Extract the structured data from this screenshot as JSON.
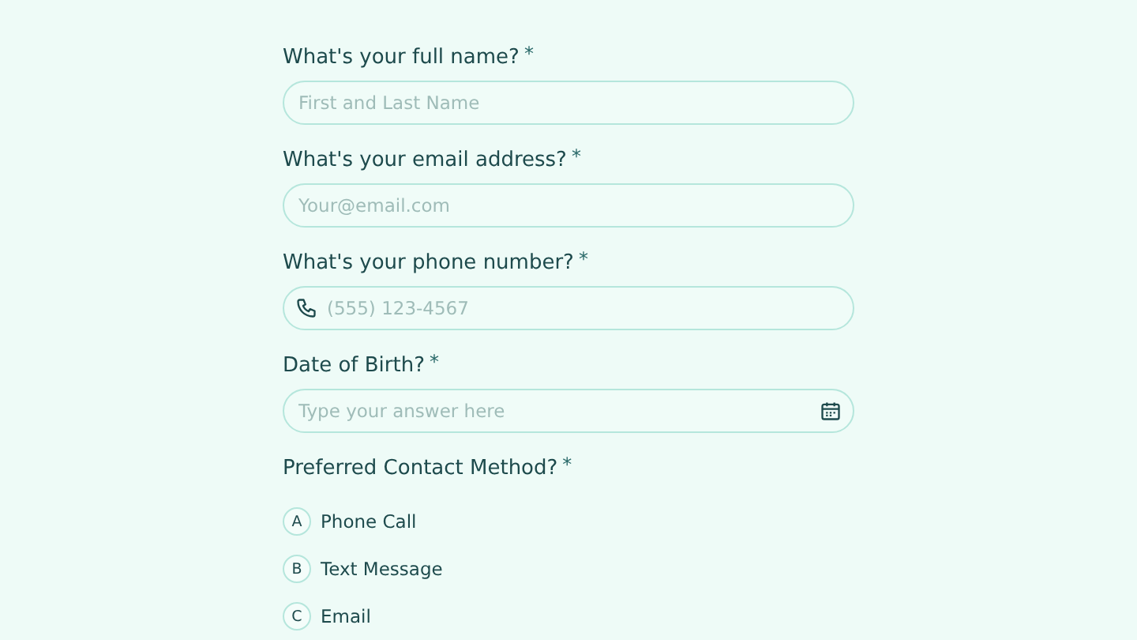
{
  "fields": [
    {
      "kind": "text",
      "label": "What's your full name?",
      "required_mark": "*",
      "placeholder": "First and Last Name"
    },
    {
      "kind": "text",
      "label": "What's your email address?",
      "required_mark": "*",
      "placeholder": "Your@email.com"
    },
    {
      "kind": "phone",
      "label": "What's your phone number?",
      "required_mark": "*",
      "placeholder": "(555) 123-4567"
    },
    {
      "kind": "date",
      "label": "Date of Birth?",
      "required_mark": "*",
      "placeholder": "Type your answer here"
    }
  ],
  "choice": {
    "label": "Preferred Contact Method?",
    "required_mark": "*",
    "options": [
      {
        "key": "A",
        "label": "Phone Call",
        "selected": false
      },
      {
        "key": "B",
        "label": "Text Message",
        "selected": false
      },
      {
        "key": "C",
        "label": "Email",
        "selected": false
      }
    ]
  }
}
